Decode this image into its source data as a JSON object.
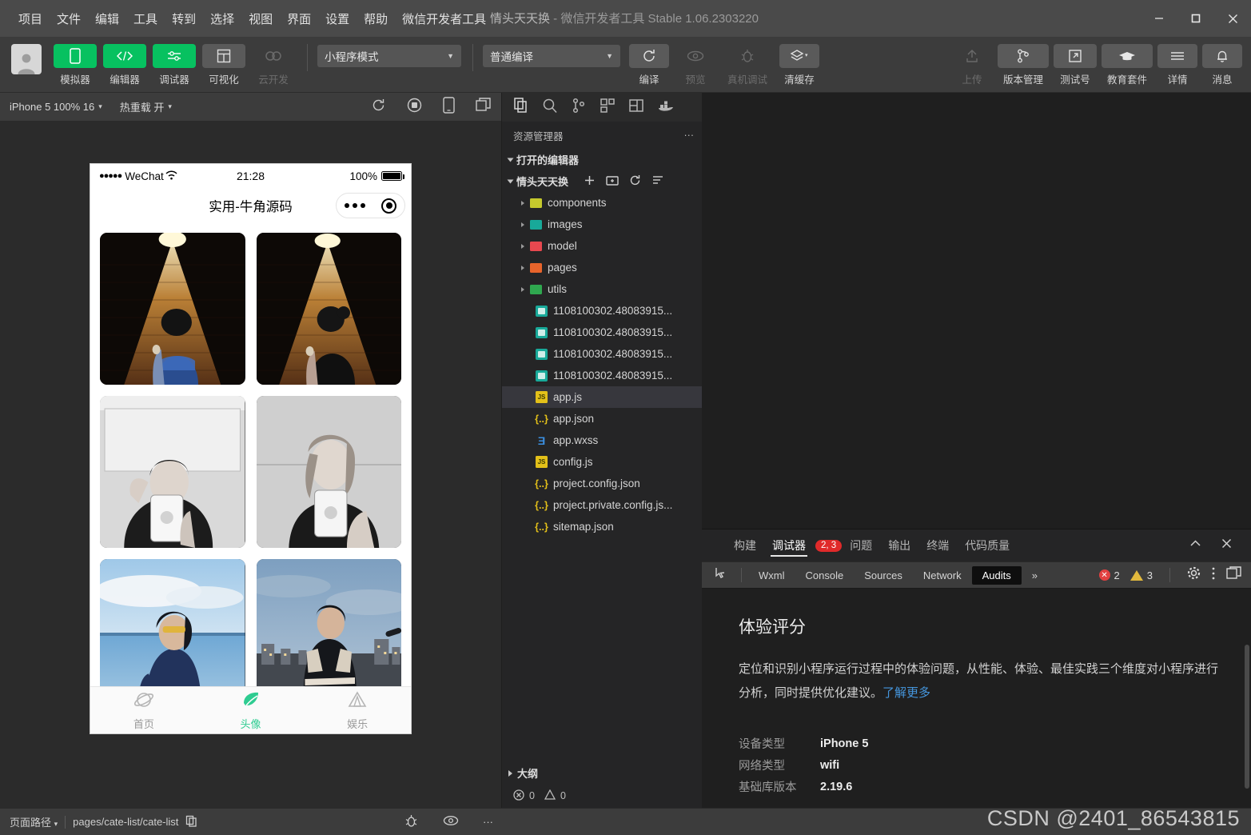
{
  "window": {
    "project_name": "情头天天换",
    "title_suffix": " - 微信开发者工具 Stable 1.06.2303220",
    "minimize": "—",
    "maximize": "□",
    "close": "✕"
  },
  "menu": {
    "items": [
      "项目",
      "文件",
      "编辑",
      "工具",
      "转到",
      "选择",
      "视图",
      "界面",
      "设置",
      "帮助",
      "微信开发者工具"
    ]
  },
  "toolbar": {
    "left_buttons": [
      {
        "label": "模拟器",
        "state": "active"
      },
      {
        "label": "编辑器",
        "state": "active"
      },
      {
        "label": "调试器",
        "state": "active"
      },
      {
        "label": "可视化",
        "state": "normal"
      },
      {
        "label": "云开发",
        "state": "disabled"
      }
    ],
    "mode_select": "小程序模式",
    "compile_select": "普通编译",
    "action_buttons": [
      {
        "label": "编译",
        "state": "normal"
      },
      {
        "label": "预览",
        "state": "disabled"
      },
      {
        "label": "真机调试",
        "state": "disabled"
      },
      {
        "label": "清缓存",
        "state": "normal"
      }
    ],
    "right_buttons": [
      {
        "label": "上传",
        "state": "disabled"
      },
      {
        "label": "版本管理",
        "state": "normal"
      },
      {
        "label": "测试号",
        "state": "normal"
      },
      {
        "label": "教育套件",
        "state": "normal"
      },
      {
        "label": "详情",
        "state": "normal"
      },
      {
        "label": "消息",
        "state": "normal"
      }
    ]
  },
  "simulator": {
    "device_select": "iPhone 5 100% 16",
    "hotreload_label": "热重载 开",
    "phone": {
      "carrier": "WeChat",
      "dots": "●●●●●",
      "time": "21:28",
      "battery_percent": "100%",
      "nav_title": "实用-牛角源码",
      "photos": [
        {
          "alt": "couple-avatar-brick-wall-boy",
          "kind": "brick-boy"
        },
        {
          "alt": "couple-avatar-brick-wall-girl",
          "kind": "brick-girl"
        },
        {
          "alt": "bw-mirror-selfie-boy",
          "kind": "bw-boy"
        },
        {
          "alt": "bw-mirror-selfie-girl",
          "kind": "bw-girl"
        },
        {
          "alt": "poolside-girl-sunglasses",
          "kind": "pool-girl"
        },
        {
          "alt": "rooftop-city-boy",
          "kind": "city-boy"
        }
      ],
      "tabs": [
        {
          "label": "首页",
          "icon": "planet-icon",
          "active": false
        },
        {
          "label": "头像",
          "icon": "avatar-leaf-icon",
          "active": true
        },
        {
          "label": "娱乐",
          "icon": "tent-icon",
          "active": false
        }
      ]
    }
  },
  "explorer": {
    "title": "资源管理器",
    "more": "···",
    "open_editors": "打开的编辑器",
    "project": "情头天天换",
    "tree": [
      {
        "name": "components",
        "type": "folder",
        "color": "#c5c92d"
      },
      {
        "name": "images",
        "type": "folder",
        "color": "#18a999"
      },
      {
        "name": "model",
        "type": "folder",
        "color": "#e8484f"
      },
      {
        "name": "pages",
        "type": "folder",
        "color": "#e8642b"
      },
      {
        "name": "utils",
        "type": "folder",
        "color": "#2fa84f"
      },
      {
        "name": "1108100302.48083915...",
        "type": "image"
      },
      {
        "name": "1108100302.48083915...",
        "type": "image"
      },
      {
        "name": "1108100302.48083915...",
        "type": "image"
      },
      {
        "name": "1108100302.48083915...",
        "type": "image"
      },
      {
        "name": "app.js",
        "type": "js",
        "selected": true
      },
      {
        "name": "app.json",
        "type": "json"
      },
      {
        "name": "app.wxss",
        "type": "wxss"
      },
      {
        "name": "config.js",
        "type": "js"
      },
      {
        "name": "project.config.json",
        "type": "json"
      },
      {
        "name": "project.private.config.js...",
        "type": "json"
      },
      {
        "name": "sitemap.json",
        "type": "json"
      }
    ],
    "outline": "大纲",
    "problems": {
      "errors": "0",
      "warnings": "0"
    }
  },
  "debugger": {
    "panel_tabs": [
      {
        "label": "构建",
        "active": false
      },
      {
        "label": "调试器",
        "active": true,
        "badge": "2, 3"
      },
      {
        "label": "问题",
        "active": false
      },
      {
        "label": "输出",
        "active": false
      },
      {
        "label": "终端",
        "active": false
      },
      {
        "label": "代码质量",
        "active": false
      }
    ],
    "devtools_tabs": [
      {
        "label": "Wxml",
        "active": false
      },
      {
        "label": "Console",
        "active": false
      },
      {
        "label": "Sources",
        "active": false
      },
      {
        "label": "Network",
        "active": false
      },
      {
        "label": "Audits",
        "active": true
      }
    ],
    "overflow": "»",
    "error_count": "2",
    "warning_count": "3",
    "audits": {
      "heading": "体验评分",
      "description": "定位和识别小程序运行过程中的体验问题，从性能、体验、最佳实践三个维度对小程序进行分析，同时提供优化建议。",
      "link": "了解更多",
      "info": [
        {
          "key": "设备类型",
          "value": "iPhone 5"
        },
        {
          "key": "网络类型",
          "value": "wifi"
        },
        {
          "key": "基础库版本",
          "value": "2.19.6"
        }
      ]
    }
  },
  "statusbar": {
    "path_label": "页面路径",
    "path_value": "pages/cate-list/cate-list"
  },
  "watermark": "CSDN @2401_86543815",
  "colors": {
    "accent_green": "#07c160",
    "tab_active_green": "#2ecc91",
    "badge_red": "#e02a2a",
    "link_blue": "#4596dd",
    "titlebar_bg": "#4a4a4a",
    "toolbar_bg": "#3c3c3c",
    "explorer_bg": "#252526",
    "panel_bg": "#1f1f1f"
  }
}
